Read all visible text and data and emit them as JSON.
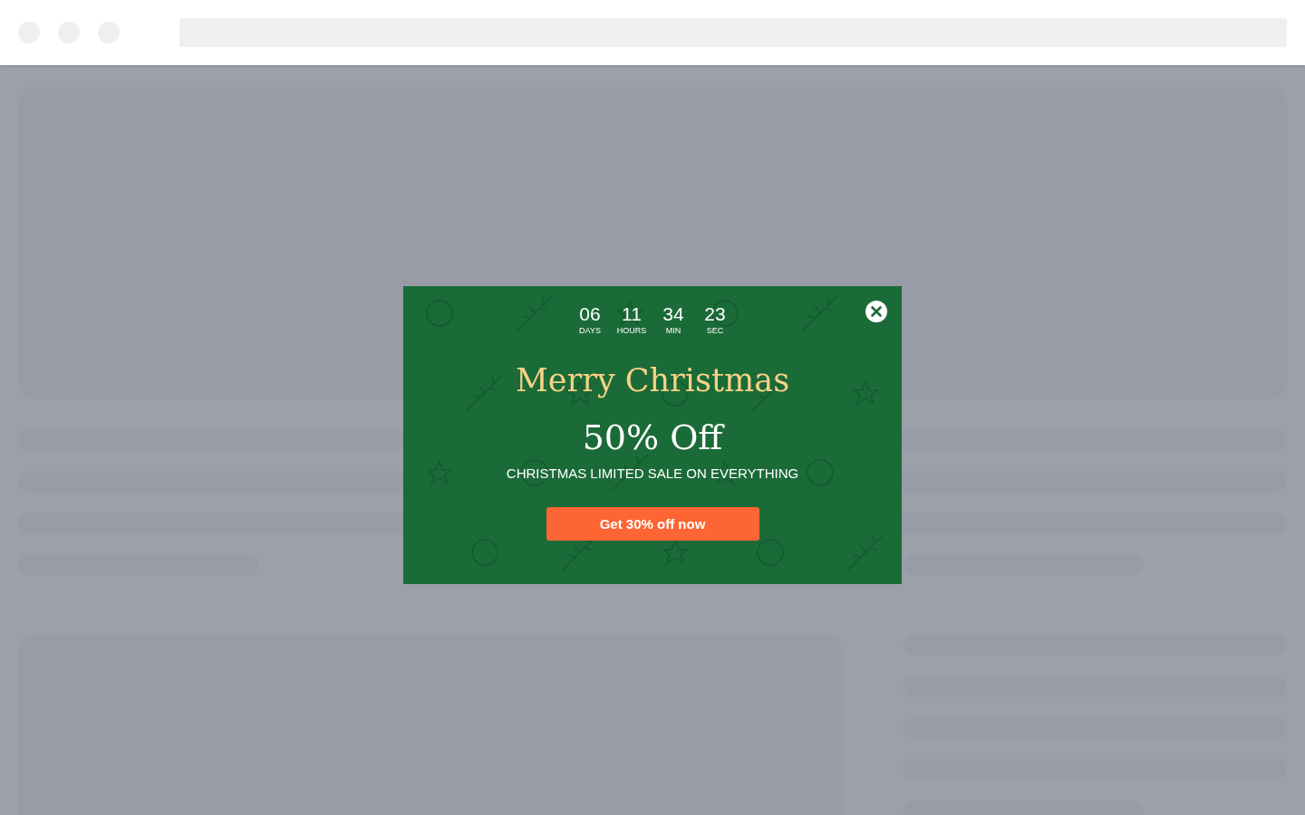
{
  "popup": {
    "countdown": [
      {
        "value": "06",
        "label": "DAYS"
      },
      {
        "value": "11",
        "label": "HOURS"
      },
      {
        "value": "34",
        "label": "MIN"
      },
      {
        "value": "23",
        "label": "SEC"
      }
    ],
    "title": "Merry Christmas",
    "discount": "50% Off",
    "subtitle": "CHRISTMAS LIMITED SALE ON EVERYTHING",
    "button": "Get 30% off now"
  }
}
